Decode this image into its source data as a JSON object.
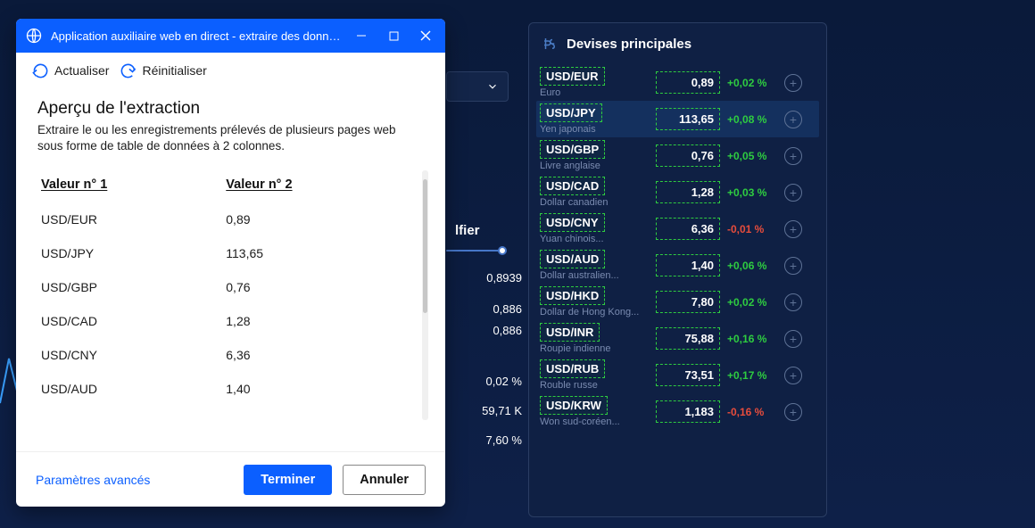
{
  "modal": {
    "window_title": "Application auxiliaire web en direct - extraire des données...",
    "toolbar_refresh": "Actualiser",
    "toolbar_reset": "Réinitialiser",
    "heading": "Aperçu de l'extraction",
    "subheading": "Extraire le ou les enregistrements prélevés de plusieurs pages web sous forme de table de données à 2 colonnes.",
    "col1": "Valeur n° 1",
    "col2": "Valeur n° 2",
    "rows": [
      {
        "c1": "USD/EUR",
        "c2": "0,89"
      },
      {
        "c1": "USD/JPY",
        "c2": "113,65"
      },
      {
        "c1": "USD/GBP",
        "c2": "0,76"
      },
      {
        "c1": "USD/CAD",
        "c2": "1,28"
      },
      {
        "c1": "USD/CNY",
        "c2": "6,36"
      },
      {
        "c1": "USD/AUD",
        "c2": "1,40"
      }
    ],
    "advanced": "Paramètres avancés",
    "ok": "Terminer",
    "cancel": "Annuler"
  },
  "bg": {
    "lfier": "lfier",
    "v1": "0,8939",
    "v2": "0,886",
    "v3": "0,886",
    "v4": "0,02 %",
    "v5": "59,71 K",
    "v6": "7,60 %"
  },
  "panel": {
    "title": "Devises principales",
    "items": [
      {
        "code": "USD/EUR",
        "name": "Euro",
        "rate": "0,89",
        "change": "+0,02 %",
        "pos": true,
        "highlight": false
      },
      {
        "code": "USD/JPY",
        "name": "Yen japonais",
        "rate": "113,65",
        "change": "+0,08 %",
        "pos": true,
        "highlight": true
      },
      {
        "code": "USD/GBP",
        "name": "Livre anglaise",
        "rate": "0,76",
        "change": "+0,05 %",
        "pos": true,
        "highlight": false
      },
      {
        "code": "USD/CAD",
        "name": "Dollar canadien",
        "rate": "1,28",
        "change": "+0,03 %",
        "pos": true,
        "highlight": false
      },
      {
        "code": "USD/CNY",
        "name": "Yuan chinois...",
        "rate": "6,36",
        "change": "-0,01 %",
        "pos": false,
        "highlight": false
      },
      {
        "code": "USD/AUD",
        "name": "Dollar australien...",
        "rate": "1,40",
        "change": "+0,06 %",
        "pos": true,
        "highlight": false
      },
      {
        "code": "USD/HKD",
        "name": "Dollar de Hong Kong...",
        "rate": "7,80",
        "change": "+0,02 %",
        "pos": true,
        "highlight": false
      },
      {
        "code": "USD/INR",
        "name": "Roupie indienne",
        "rate": "75,88",
        "change": "+0,16 %",
        "pos": true,
        "highlight": false
      },
      {
        "code": "USD/RUB",
        "name": "Rouble russe",
        "rate": "73,51",
        "change": "+0,17 %",
        "pos": true,
        "highlight": false
      },
      {
        "code": "USD/KRW",
        "name": "Won sud-coréen...",
        "rate": "1,183",
        "change": "-0,16 %",
        "pos": false,
        "highlight": false
      }
    ]
  }
}
